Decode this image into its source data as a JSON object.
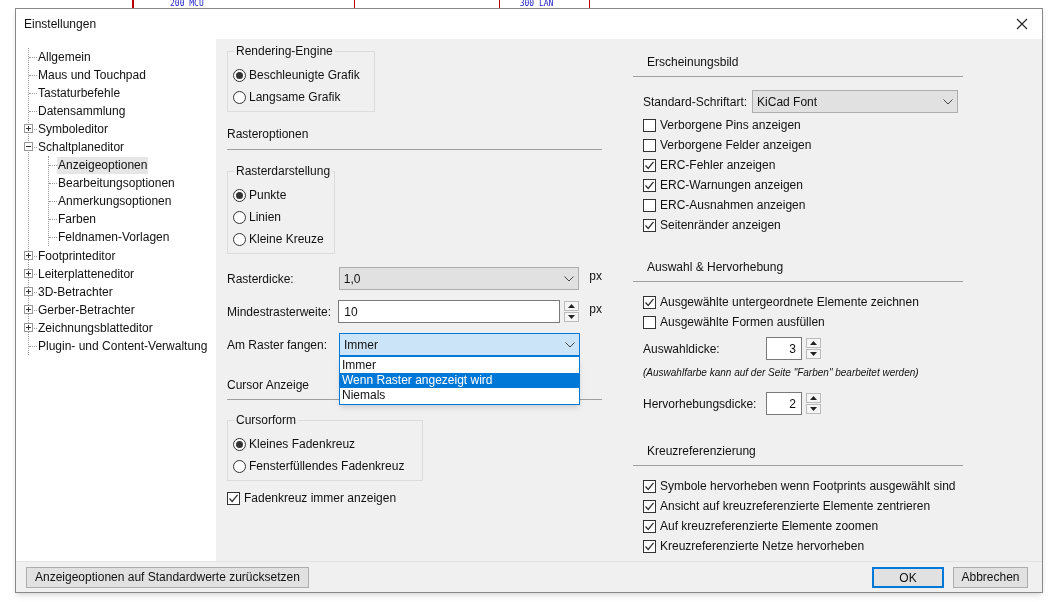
{
  "background": {
    "labels": [
      "200 MCU",
      "300 LAN"
    ]
  },
  "window": {
    "title": "Einstellungen"
  },
  "tree": [
    {
      "label": "Allgemein",
      "selected": false
    },
    {
      "label": "Maus und Touchpad",
      "selected": false
    },
    {
      "label": "Tastaturbefehle",
      "selected": false
    },
    {
      "label": "Datensammlung",
      "selected": false
    },
    {
      "label": "Symboleditor",
      "selected": false,
      "expanded": false
    },
    {
      "label": "Schaltplaneditor",
      "selected": false,
      "expanded": true,
      "children": [
        {
          "label": "Anzeigeoptionen",
          "selected": true
        },
        {
          "label": "Bearbeitungsoptionen",
          "selected": false
        },
        {
          "label": "Anmerkungsoptionen",
          "selected": false
        },
        {
          "label": "Farben",
          "selected": false
        },
        {
          "label": "Feldnamen-Vorlagen",
          "selected": false
        }
      ]
    },
    {
      "label": "Footprinteditor",
      "selected": false,
      "expanded": false
    },
    {
      "label": "Leiterplatteneditor",
      "selected": false,
      "expanded": false
    },
    {
      "label": "3D-Betrachter",
      "selected": false,
      "expanded": false
    },
    {
      "label": "Gerber-Betrachter",
      "selected": false,
      "expanded": false
    },
    {
      "label": "Zeichnungsblatteditor",
      "selected": false,
      "expanded": false
    },
    {
      "label": "Plugin- und Content-Verwaltung",
      "selected": false
    }
  ],
  "rendering_engine": {
    "title": "Rendering-Engine",
    "options": [
      {
        "label": "Beschleunigte Grafik",
        "selected": true
      },
      {
        "label": "Langsame Grafik",
        "selected": false
      }
    ]
  },
  "grid_options": {
    "heading": "Rasteroptionen",
    "grid_style": {
      "title": "Rasterdarstellung",
      "options": [
        {
          "label": "Punkte",
          "selected": true
        },
        {
          "label": "Linien",
          "selected": false
        },
        {
          "label": "Kleine Kreuze",
          "selected": false
        }
      ]
    },
    "grid_thickness": {
      "label": "Rasterdicke:",
      "value": "1,0",
      "unit": "px"
    },
    "min_grid_spacing": {
      "label": "Mindestrasterweite:",
      "value": "10",
      "unit": "px"
    },
    "snap_to_grid": {
      "label": "Am Raster fangen:",
      "value": "Immer",
      "expanded": true,
      "options": [
        {
          "label": "Immer",
          "highlighted": false
        },
        {
          "label": "Wenn Raster angezeigt wird",
          "highlighted": true
        },
        {
          "label": "Niemals",
          "highlighted": false
        }
      ]
    }
  },
  "cursor": {
    "heading": "Cursor Anzeige",
    "cursor_shape": {
      "title": "Cursorform",
      "options": [
        {
          "label": "Kleines Fadenkreuz",
          "selected": true
        },
        {
          "label": "Fensterfüllendes Fadenkreuz",
          "selected": false
        }
      ]
    },
    "always_show": {
      "label": "Fadenkreuz immer anzeigen",
      "checked": true
    }
  },
  "appearance": {
    "heading": "Erscheinungsbild",
    "font": {
      "label": "Standard-Schriftart:",
      "value": "KiCad Font"
    },
    "checkboxes": [
      {
        "label": "Verborgene Pins anzeigen",
        "checked": false
      },
      {
        "label": "Verborgene Felder anzeigen",
        "checked": false
      },
      {
        "label": "ERC-Fehler anzeigen",
        "checked": true
      },
      {
        "label": "ERC-Warnungen anzeigen",
        "checked": true
      },
      {
        "label": "ERC-Ausnahmen anzeigen",
        "checked": false
      },
      {
        "label": "Seitenränder anzeigen",
        "checked": true
      }
    ]
  },
  "selection": {
    "heading": "Auswahl & Hervorhebung",
    "checkboxes": [
      {
        "label": "Ausgewählte untergeordnete Elemente zeichnen",
        "checked": true
      },
      {
        "label": "Ausgewählte Formen ausfüllen",
        "checked": false
      }
    ],
    "selection_thickness": {
      "label": "Auswahldicke:",
      "value": "3"
    },
    "note": "(Auswahlfarbe kann auf der Seite \"Farben\" bearbeitet werden)",
    "highlight_thickness": {
      "label": "Hervorhebungsdicke:",
      "value": "2"
    }
  },
  "cross_reference": {
    "heading": "Kreuzreferenzierung",
    "checkboxes": [
      {
        "label": "Symbole hervorheben wenn Footprints ausgewählt sind",
        "checked": true
      },
      {
        "label": "Ansicht auf kreuzreferenzierte Elemente zentrieren",
        "checked": true
      },
      {
        "label": "Auf kreuzreferenzierte Elemente zoomen",
        "checked": true
      },
      {
        "label": "Kreuzreferenzierte Netze hervorheben",
        "checked": true
      }
    ]
  },
  "buttons": {
    "reset": "Anzeigeoptionen auf Standardwerte zurücksetzen",
    "ok": "OK",
    "cancel": "Abbrechen"
  }
}
